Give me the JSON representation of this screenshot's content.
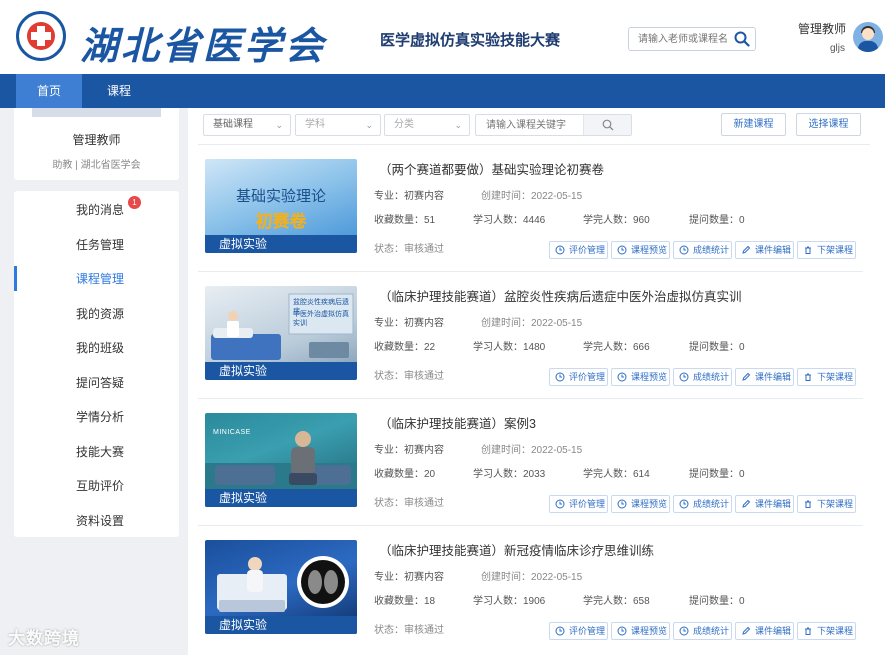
{
  "header": {
    "logo_text": "湖北省医学会",
    "contest_title": "医学虚拟仿真实验技能大赛",
    "search_placeholder": "请输入老师或课程名",
    "user_name": "管理教师",
    "user_id": "gljs"
  },
  "nav": {
    "home": "首页",
    "course": "课程"
  },
  "profile": {
    "name": "管理教师",
    "role": "助教 | 湖北省医学会"
  },
  "menu": {
    "unread_badge": "1",
    "items": [
      {
        "label": "我的消息"
      },
      {
        "label": "任务管理"
      },
      {
        "label": "课程管理",
        "active": true
      },
      {
        "label": "我的资源"
      },
      {
        "label": "我的班级"
      },
      {
        "label": "提问答疑"
      },
      {
        "label": "学情分析"
      },
      {
        "label": "技能大赛"
      },
      {
        "label": "互助评价"
      },
      {
        "label": "资料设置"
      }
    ]
  },
  "filters": {
    "course_type": "基础课程",
    "subject": "学科",
    "category": "分类",
    "keyword_placeholder": "请输入课程关键字",
    "new_course": "新建课程",
    "choose_course": "选择课程"
  },
  "labels": {
    "major": "专业：",
    "created": "创建时间：",
    "favorites": "收藏数量：",
    "learners": "学习人数：",
    "finished": "学完人数：",
    "questions": "提问数量：",
    "status": "状态："
  },
  "actions": [
    "评价管理",
    "课程预览",
    "成绩统计",
    "课件编辑",
    "下架课程"
  ],
  "thumb_tag": "虚拟实验",
  "courses": [
    {
      "title": "（两个赛道都要做）基础实验理论初赛卷",
      "major": "初赛内容",
      "created": "2022-05-15",
      "favorites": "51",
      "learners": "4446",
      "finished": "960",
      "questions": "0",
      "status": "审核通过",
      "thumb_line1": "基础实验理论",
      "thumb_line2": "初赛卷"
    },
    {
      "title": "（临床护理技能赛道）盆腔炎性疾病后遗症中医外治虚拟仿真实训",
      "major": "初赛内容",
      "created": "2022-05-15",
      "favorites": "22",
      "learners": "1480",
      "finished": "666",
      "questions": "0",
      "status": "审核通过",
      "thumb_line1": "盆腔炎性疾病后遗症",
      "thumb_line2": "中医外治虚拟仿真实训"
    },
    {
      "title": "（临床护理技能赛道）案例3",
      "major": "初赛内容",
      "created": "2022-05-15",
      "favorites": "20",
      "learners": "2033",
      "finished": "614",
      "questions": "0",
      "status": "审核通过",
      "thumb_line1": "MINICASE"
    },
    {
      "title": "（临床护理技能赛道）新冠疫情临床诊疗思维训练",
      "major": "初赛内容",
      "created": "2022-05-15",
      "favorites": "18",
      "learners": "1906",
      "finished": "658",
      "questions": "0",
      "status": "审核通过"
    }
  ],
  "watermark": "大数跨境"
}
